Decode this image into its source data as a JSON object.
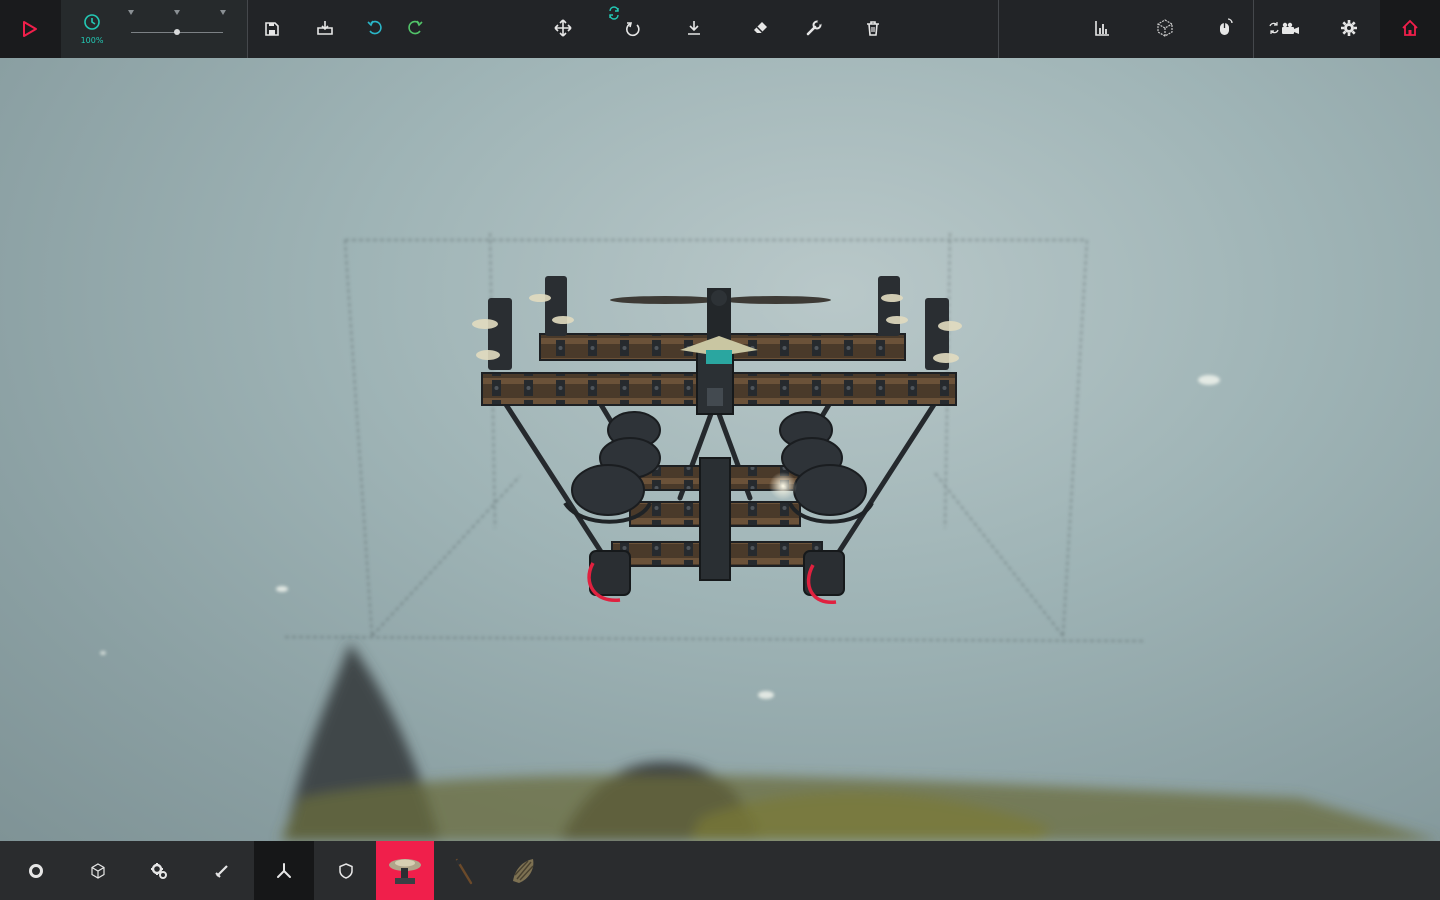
{
  "toolbar": {
    "speed_label": "100%",
    "speed_slider_fraction": 0.5,
    "buttons": [
      "play",
      "time-scale",
      "save",
      "load",
      "undo",
      "redo",
      "translate",
      "rotate",
      "snap-to-ground",
      "erase",
      "modify",
      "delete",
      "statistics",
      "bounding-box",
      "mouse-control",
      "camera",
      "settings",
      "home"
    ]
  },
  "bottombar": {
    "categories": [
      "basic-blocks",
      "geometry",
      "mechanical",
      "weaponry",
      "flight",
      "armour",
      "cannon-ornament",
      "spear",
      "shell"
    ],
    "active_category": "cannon-ornament"
  },
  "colors": {
    "accent": "#f01f4b",
    "speed_accent": "#23c9b5",
    "undo": "#2ab6c8",
    "redo": "#52c469",
    "toolbar_bg": "#222427",
    "bottombar_bg": "#2a2c2e"
  }
}
